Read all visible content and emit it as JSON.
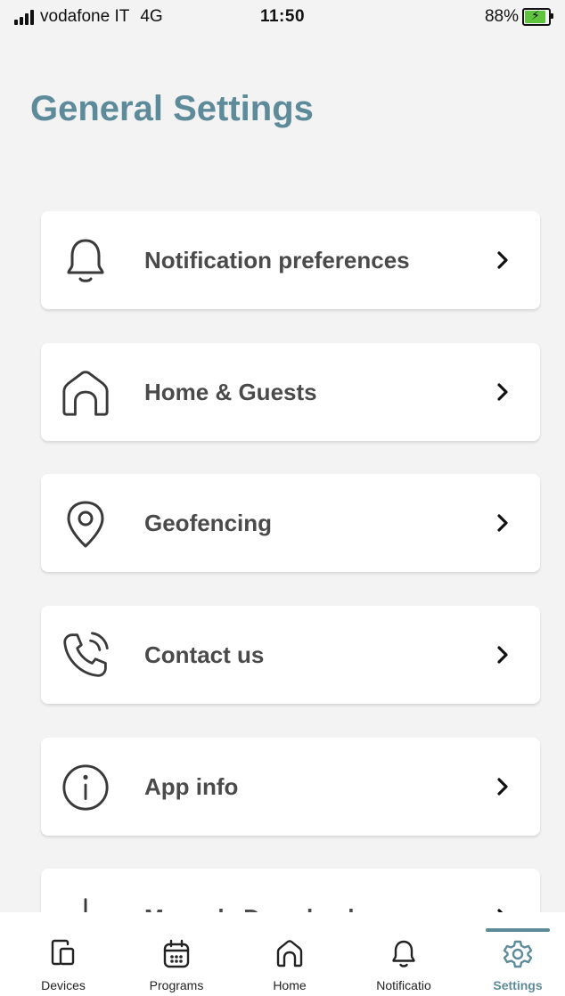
{
  "status_bar": {
    "carrier": "vodafone IT",
    "network": "4G",
    "time": "11:50",
    "battery": "88%",
    "battery_level": 0.88
  },
  "page": {
    "title": "General Settings"
  },
  "settings": {
    "items": [
      {
        "label": "Notification preferences",
        "icon": "bell-icon"
      },
      {
        "label": "Home & Guests",
        "icon": "home-icon"
      },
      {
        "label": "Geofencing",
        "icon": "location-pin-icon"
      },
      {
        "label": "Contact us",
        "icon": "phone-icon"
      },
      {
        "label": "App info",
        "icon": "info-icon"
      },
      {
        "label": "Manuals Download",
        "icon": "download-icon"
      }
    ]
  },
  "tab_bar": {
    "tabs": [
      {
        "label": "Devices",
        "icon": "devices-icon"
      },
      {
        "label": "Programs",
        "icon": "calendar-icon"
      },
      {
        "label": "Home",
        "icon": "home-icon"
      },
      {
        "label": "Notificatio",
        "icon": "bell-icon"
      },
      {
        "label": "Settings",
        "icon": "gear-icon"
      }
    ],
    "active": "Settings"
  },
  "colors": {
    "accent": "#5e8b9a",
    "background": "#f3f3f3",
    "card": "#ffffff",
    "battery": "#5ec43d"
  }
}
